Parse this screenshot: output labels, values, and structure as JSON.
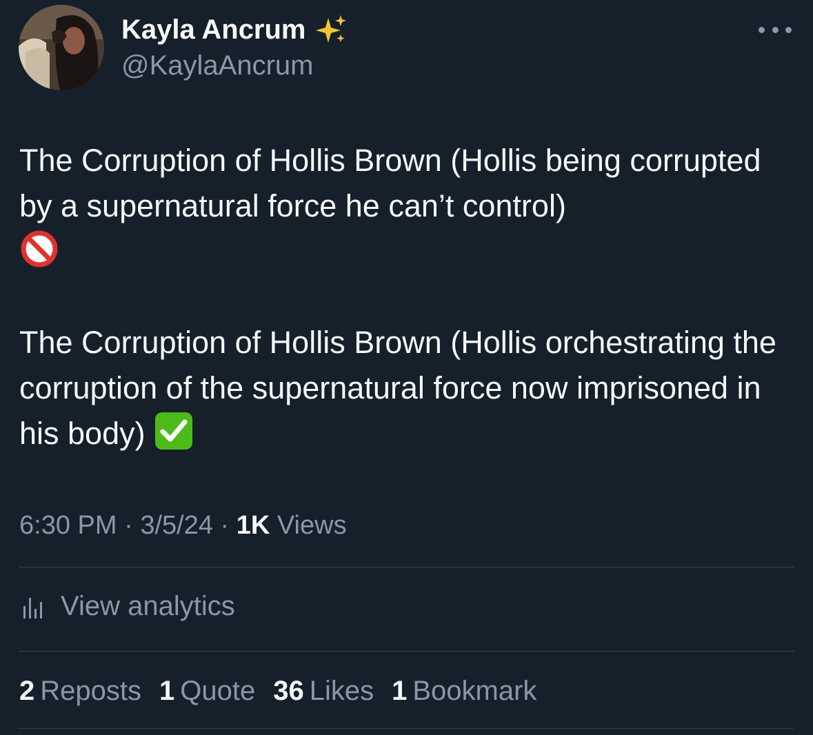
{
  "author": {
    "display_name": "Kayla Ancrum",
    "handle": "@KaylaAncrum",
    "badge_icon": "sparkles-icon"
  },
  "tweet": {
    "paragraph_1": "The Corruption of Hollis Brown (Hollis being corrupted by a supernatural force he can’t control)",
    "paragraph_1_emoji": "prohibited-icon",
    "paragraph_2": "The Corruption of Hollis Brown (Hollis orchestrating the corruption of the supernatural force now imprisoned in his body)",
    "paragraph_2_emoji": "check-mark-button-icon"
  },
  "meta": {
    "time": "6:30 PM",
    "separator": "·",
    "date": "3/5/24",
    "views_count": "1K",
    "views_label": "Views"
  },
  "analytics": {
    "label": "View analytics"
  },
  "stats": {
    "reposts_count": "2",
    "reposts_label": "Reposts",
    "quotes_count": "1",
    "quotes_label": "Quote",
    "likes_count": "36",
    "likes_label": "Likes",
    "bookmarks_count": "1",
    "bookmarks_label": "Bookmark"
  },
  "colors": {
    "background": "#15202b",
    "primary_text": "#f7f9f9",
    "secondary_text": "#8b98a5",
    "divider": "#38444d"
  }
}
